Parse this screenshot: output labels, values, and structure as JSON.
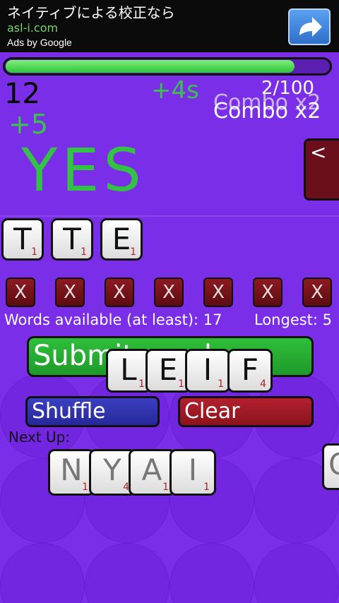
{
  "ad": {
    "title": "ネイティブによる校正なら",
    "url": "asl-i.com",
    "by": "Ads by Google",
    "button_icon": "share-arrow-icon"
  },
  "game": {
    "progress_fraction": 0.9,
    "score": "12",
    "time_bonus": "+4s",
    "counter": "2/100",
    "combo": "Combo x2",
    "points_gain": "+5",
    "result": "YES",
    "back_label": "<",
    "current_word": [
      {
        "letter": "T",
        "points": "1"
      },
      {
        "letter": "T",
        "points": "1"
      },
      {
        "letter": "E",
        "points": "1"
      }
    ],
    "slots": [
      "X",
      "X",
      "X",
      "X",
      "X",
      "X",
      "X"
    ],
    "words_available": "Words available (at least): 17",
    "longest": "Longest: 5",
    "submit_label": "Submit word",
    "floating_tiles": [
      {
        "letter": "L",
        "points": "1"
      },
      {
        "letter": "E",
        "points": "1"
      },
      {
        "letter": "I",
        "points": "1"
      },
      {
        "letter": "F",
        "points": "4"
      }
    ],
    "shuffle_label": "Shuffle",
    "clear_label": "Clear",
    "next_up_label": "Next Up:",
    "next_tiles": [
      {
        "letter": "N",
        "points": "1"
      },
      {
        "letter": "Y",
        "points": "4"
      },
      {
        "letter": "A",
        "points": "1"
      },
      {
        "letter": "I",
        "points": "1"
      }
    ],
    "edge_tile_letter": "O"
  },
  "colors": {
    "board": "#7a2ee8",
    "green": "#33c244",
    "blue": "#26289a",
    "red": "#8c141e"
  }
}
